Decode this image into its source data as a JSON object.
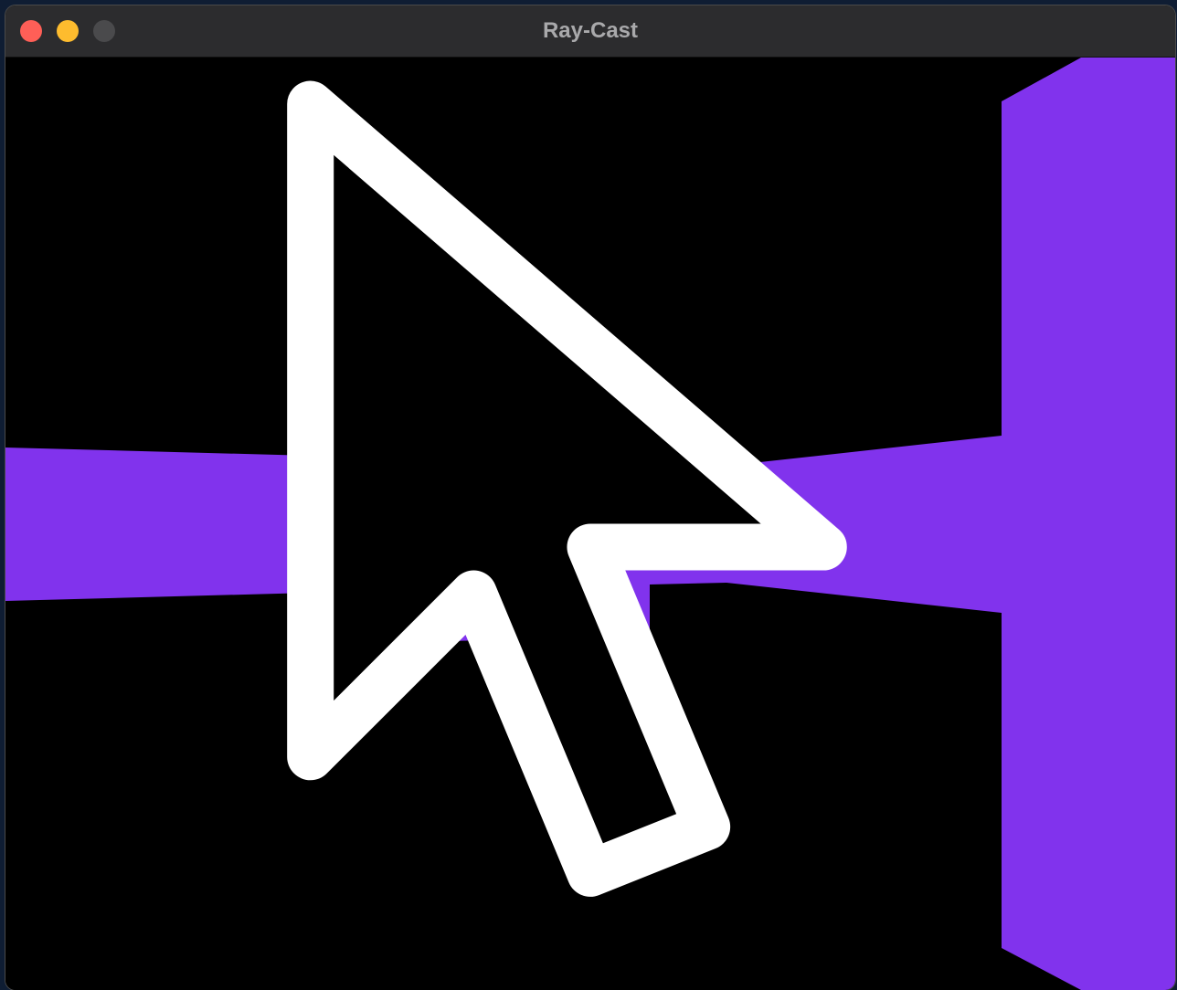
{
  "window": {
    "title": "Ray-Cast"
  },
  "scene": {
    "background_color": "#000000",
    "wall_color": "#8133ed"
  },
  "cursor": {
    "icon": "arrow-pointer-icon"
  }
}
